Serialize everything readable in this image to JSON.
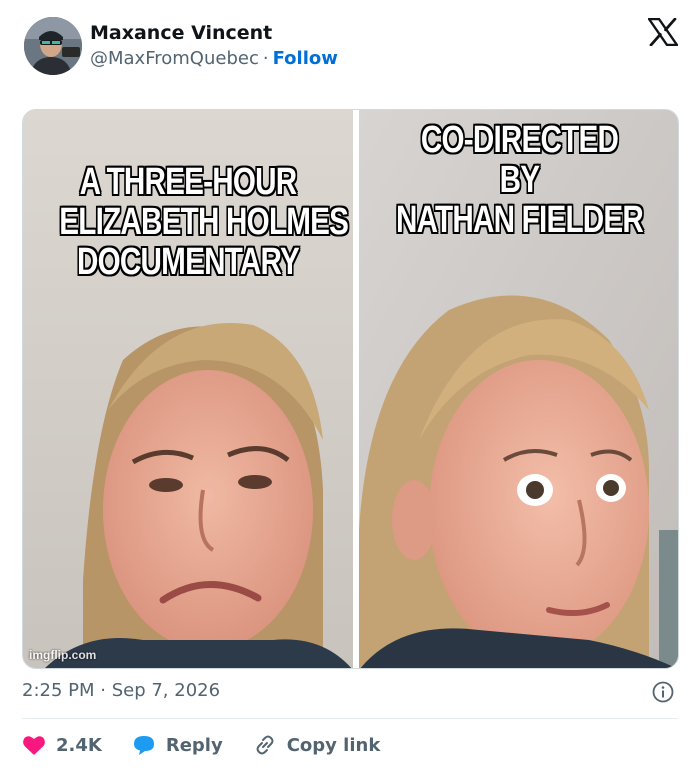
{
  "author": {
    "name": "Maxance Vincent",
    "handle": "@MaxFromQuebec",
    "separator": "·",
    "follow_label": "Follow"
  },
  "icons": {
    "platform": "x-logo-icon",
    "info": "info-icon",
    "like": "heart-icon",
    "reply": "speech-bubble-icon",
    "copy": "link-icon"
  },
  "media": {
    "meme_left_caption": [
      "A THREE-HOUR",
      "ELIZABETH HOLMES",
      "DOCUMENTARY"
    ],
    "meme_right_caption": [
      "CO-DIRECTED",
      "BY",
      "NATHAN FIELDER"
    ],
    "watermark": "imgflip.com"
  },
  "timestamp": "2:25 PM · Sep 7, 2026",
  "actions": {
    "likes": "2.4K",
    "reply_label": "Reply",
    "copy_label": "Copy link"
  },
  "colors": {
    "follow": "#006fd6",
    "like": "#f91880",
    "reply": "#1d9bf0",
    "secondary_text": "#536471"
  }
}
